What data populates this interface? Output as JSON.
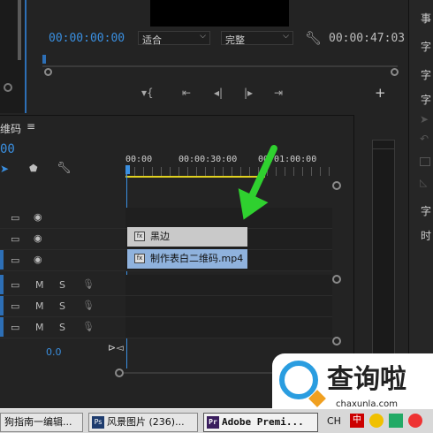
{
  "monitor": {
    "current_timecode": "00:00:00:00",
    "fit_select": "适合",
    "quality_select": "完整",
    "duration_timecode": "00:00:47:03"
  },
  "timeline": {
    "panel_title": "维码",
    "timecode_partial": "00",
    "ruler": [
      "00:00",
      "00:00:30:00",
      "00:01:00:00"
    ],
    "clips": [
      {
        "label": "黑边",
        "color": "#c9c9c9"
      },
      {
        "label": "制作表白二维码.mp4",
        "color": "#8fb2dd"
      }
    ],
    "audio_row_labels": {
      "mute": "M",
      "solo": "S"
    },
    "volume_value": "0.0"
  },
  "right_column": {
    "items": [
      "事",
      "字",
      "字",
      "字",
      "字",
      "时"
    ]
  },
  "taskbar": {
    "tasks": [
      {
        "label": "狗指南一编辑...",
        "icon": ""
      },
      {
        "label": "风景图片 (236)...",
        "icon": "Ps"
      },
      {
        "label": "Adobe Premi...",
        "icon": "Pr"
      }
    ],
    "lang": "CH"
  },
  "watermark": {
    "text": "查询啦",
    "url": "chaxunla.com"
  },
  "colors": {
    "accent_blue": "#2d6fb6",
    "timecode_blue": "#3a8fe0",
    "arrow_green": "#2fd12f"
  }
}
